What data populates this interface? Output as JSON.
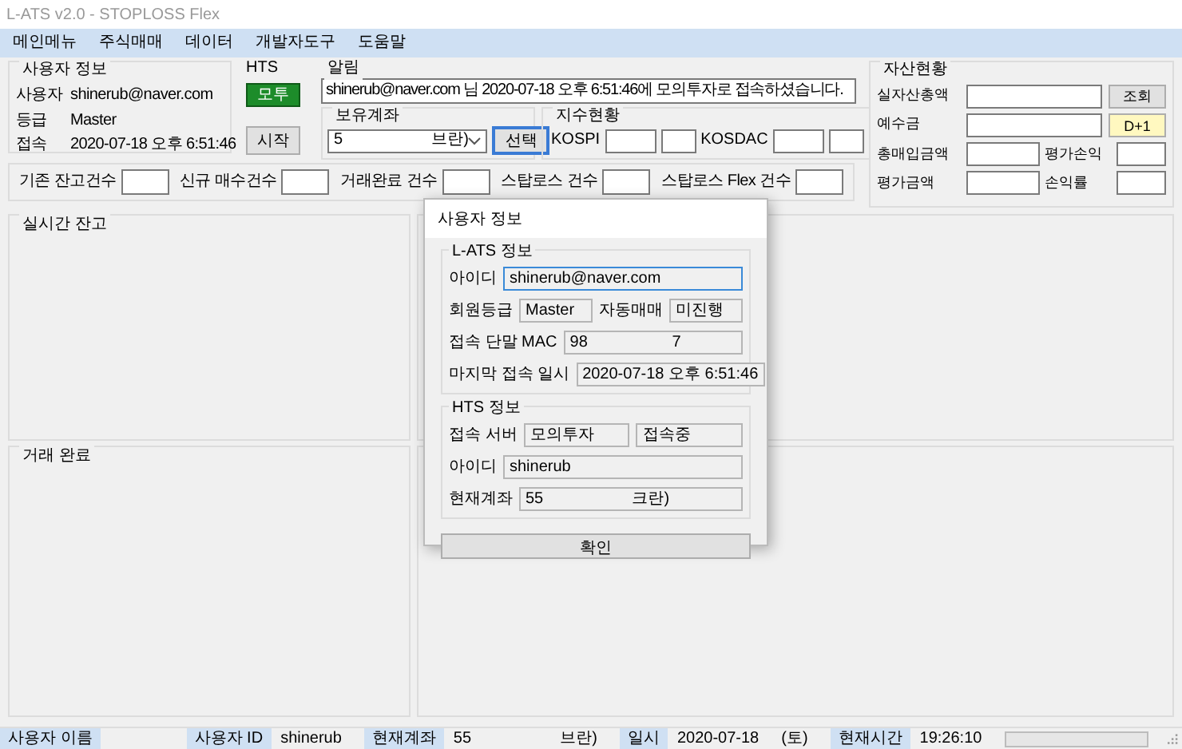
{
  "window": {
    "title": "L-ATS v2.0 - STOPLOSS Flex"
  },
  "menu": [
    "메인메뉴",
    "주식매매",
    "데이터",
    "개발자도구",
    "도움말"
  ],
  "user_info": {
    "title": "사용자 정보",
    "rows": [
      {
        "label": "사용자",
        "value": "shinerub@naver.com"
      },
      {
        "label": "등급",
        "value": "Master"
      },
      {
        "label": "접속",
        "value": "2020-07-18 오후 6:51:46"
      }
    ]
  },
  "hts": {
    "title": "HTS",
    "status": "모투",
    "start_button": "시작"
  },
  "notice": {
    "title": "알림",
    "message": "shinerub@naver.com 님 2020-07-18 오후 6:51:46에 모의투자로 접속하셨습니다."
  },
  "account": {
    "title": "보유계좌",
    "value": "5                    브란)",
    "button": "선택"
  },
  "index": {
    "title": "지수현황",
    "items": [
      {
        "label": "KOSPI"
      },
      {
        "label": "KOSDAC"
      }
    ]
  },
  "assets": {
    "title": "자산현황",
    "fields": [
      {
        "label": "실자산총액",
        "button": "조회",
        "highlight": false
      },
      {
        "label": "예수금",
        "button": "D+1",
        "highlight": true
      },
      {
        "label": "총매입금액"
      },
      {
        "label": "평가손익"
      },
      {
        "label": "평가금액"
      },
      {
        "label": "손익률"
      }
    ]
  },
  "counts": [
    "기존 잔고건수",
    "신규 매수건수",
    "거래완료 건수",
    "스탑로스 건수",
    "스탑로스 Flex 건수"
  ],
  "panels": {
    "realtime": "실시간 잔고",
    "completed": "거래 완료"
  },
  "dialog": {
    "title": "사용자 정보",
    "sections": [
      {
        "title": "L-ATS 정보",
        "rows": [
          [
            {
              "kind": "label",
              "text": "아이디"
            },
            {
              "kind": "field",
              "text": "shinerub@naver.com",
              "focused": true
            }
          ],
          [
            {
              "kind": "label",
              "text": "회원등급"
            },
            {
              "kind": "field",
              "text": "Master"
            },
            {
              "kind": "label",
              "text": "자동매매"
            },
            {
              "kind": "field",
              "text": "미진행"
            }
          ],
          [
            {
              "kind": "label",
              "text": "접속 단말 MAC"
            },
            {
              "kind": "field",
              "text": "98                   7"
            }
          ],
          [
            {
              "kind": "label",
              "text": "마지막 접속 일시"
            },
            {
              "kind": "field",
              "text": "2020-07-18 오후 6:51:46"
            }
          ]
        ]
      },
      {
        "title": "HTS 정보",
        "rows": [
          [
            {
              "kind": "label",
              "text": "접속 서버"
            },
            {
              "kind": "field",
              "text": "모의투자"
            },
            {
              "kind": "field",
              "text": "접속중"
            }
          ],
          [
            {
              "kind": "label",
              "text": "아이디"
            },
            {
              "kind": "field",
              "text": "shinerub"
            }
          ],
          [
            {
              "kind": "label",
              "text": "현재계좌"
            },
            {
              "kind": "field",
              "text": "55                    크란)"
            }
          ]
        ]
      }
    ],
    "button": "확인"
  },
  "status_bar": {
    "items": [
      {
        "kind": "label",
        "text": "사용자 이름"
      },
      {
        "kind": "label",
        "text": "사용자 ID"
      },
      {
        "kind": "value",
        "text": "shinerub"
      },
      {
        "kind": "label",
        "text": "현재계좌"
      },
      {
        "kind": "value",
        "text": "55                    브란)"
      },
      {
        "kind": "label",
        "text": "일시"
      },
      {
        "kind": "value",
        "text": "2020-07-18"
      },
      {
        "kind": "value",
        "text": "(토)"
      },
      {
        "kind": "label",
        "text": "현재시간"
      },
      {
        "kind": "value",
        "text": "19:26:10"
      }
    ],
    "progress": {
      "level": 0
    }
  }
}
